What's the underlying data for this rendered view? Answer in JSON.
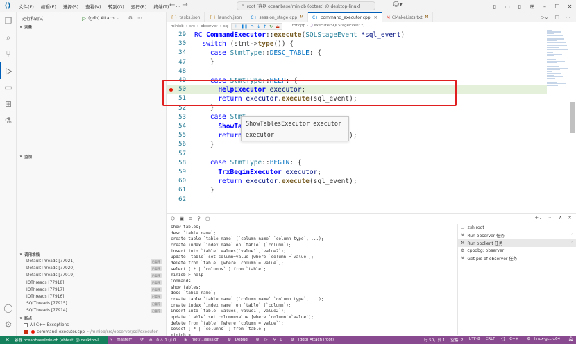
{
  "titlebar": {
    "menu": [
      "文件(F)",
      "编辑(E)",
      "选择(S)",
      "查看(V)",
      "转到(G)",
      "运行(R)",
      "终端(T)",
      "…"
    ],
    "command_center": "root [容器 oceanbase/miniob (obtest) @ desktop-linux]"
  },
  "sidebar": {
    "run_debug_title": "运行和调试",
    "config_name": "(gdb) Attach",
    "sections": {
      "variables": "变量",
      "watch": "监视",
      "call_stack": "调用堆栈",
      "breakpoints": "断点"
    },
    "threads": [
      {
        "name": "DefaultThreads [77921]",
        "state": "已暂停"
      },
      {
        "name": "DefaultThreads [77920]",
        "state": "已暂停"
      },
      {
        "name": "DefaultThreads [77919]",
        "state": "已暂停"
      },
      {
        "name": "IOThreads [77918]",
        "state": "已暂停"
      },
      {
        "name": "IOThreads [77917]",
        "state": "已暂停"
      },
      {
        "name": "IOThreads [77916]",
        "state": "已暂停"
      },
      {
        "name": "SQLThreads [77915]",
        "state": "已暂停"
      },
      {
        "name": "SQLThreads [77914]",
        "state": "已暂停"
      }
    ],
    "breakpoints": {
      "all_exceptions": "All C++ Exceptions",
      "file": "command_executor.cpp",
      "path": "~/miniob/src/observer/sql/executor"
    }
  },
  "tabs": [
    {
      "label": "tasks.json",
      "modified": "",
      "active": false
    },
    {
      "label": "launch.json",
      "modified": "",
      "active": false
    },
    {
      "label": "session_stage.cpp",
      "modified": "M",
      "active": false
    },
    {
      "label": "command_executor.cpp",
      "modified": "",
      "active": true
    },
    {
      "label": "CMakeLists.txt",
      "modified": "M",
      "active": false
    }
  ],
  "breadcrumb": {
    "parts": [
      "miniob",
      "src",
      "observer",
      "sql"
    ],
    "file": "tor.cpp",
    "symbol": "execute(SQLStageEvent *)"
  },
  "editor": {
    "lines": [
      {
        "n": "29",
        "tokens": [
          [
            "RC ",
            "kw"
          ],
          [
            "CommandExecutor",
            "cls"
          ],
          [
            "::",
            "op"
          ],
          [
            "execute",
            "fn"
          ],
          [
            "(",
            "op"
          ],
          [
            "SQLStageEvent ",
            "ty"
          ],
          [
            "*sql_event",
            "var"
          ],
          [
            ")",
            "op"
          ]
        ]
      },
      {
        "n": "30",
        "tokens": [
          [
            "  switch ",
            "kw"
          ],
          [
            "(stmt->",
            "op"
          ],
          [
            "type",
            "fn"
          ],
          [
            "()) {",
            "op"
          ]
        ]
      },
      {
        "n": "34",
        "tokens": [
          [
            "    case ",
            "kw"
          ],
          [
            "StmtType",
            "ty"
          ],
          [
            "::",
            "op"
          ],
          [
            "DESC_TABLE",
            "enm"
          ],
          [
            ": {",
            "op"
          ]
        ]
      },
      {
        "n": "47",
        "tokens": [
          [
            "    }",
            "op"
          ]
        ]
      },
      {
        "n": "48",
        "tokens": [
          [
            "",
            "op"
          ]
        ]
      },
      {
        "n": "49",
        "tokens": [
          [
            "    case ",
            "kw"
          ],
          [
            "StmtType",
            "ty"
          ],
          [
            "::",
            "op"
          ],
          [
            "HELP",
            "enm"
          ],
          [
            ": {",
            "op"
          ]
        ]
      },
      {
        "n": "50",
        "tokens": [
          [
            "      HelpExecutor ",
            "cls"
          ],
          [
            "executor",
            "var"
          ],
          [
            ";",
            "op"
          ]
        ]
      },
      {
        "n": "51",
        "tokens": [
          [
            "      return ",
            "kw"
          ],
          [
            "executor",
            "var"
          ],
          [
            ".",
            "op"
          ],
          [
            "execute",
            "fn"
          ],
          [
            "(sql_event);",
            "op"
          ]
        ]
      },
      {
        "n": "52",
        "tokens": [
          [
            "    }",
            "op"
          ]
        ]
      },
      {
        "n": "53",
        "tokens": [
          [
            "    case ",
            "kw"
          ],
          [
            "Stmt",
            "ty"
          ]
        ]
      },
      {
        "n": "54",
        "tokens": [
          [
            "      ShowTab",
            "cls"
          ]
        ]
      },
      {
        "n": "55",
        "tokens": [
          [
            "      return ",
            "kw"
          ],
          [
            "executor",
            "ul"
          ],
          [
            ".",
            "op"
          ],
          [
            "execute",
            "fn"
          ],
          [
            "(sql_event);",
            "op"
          ]
        ]
      },
      {
        "n": "56",
        "tokens": [
          [
            "    }",
            "op"
          ]
        ]
      },
      {
        "n": "57",
        "tokens": [
          [
            "",
            "op"
          ]
        ]
      },
      {
        "n": "58",
        "tokens": [
          [
            "    case ",
            "kw"
          ],
          [
            "StmtType",
            "ty"
          ],
          [
            "::",
            "op"
          ],
          [
            "BEGIN",
            "enm"
          ],
          [
            ": {",
            "op"
          ]
        ]
      },
      {
        "n": "59",
        "tokens": [
          [
            "      TrxBeginExecutor ",
            "cls"
          ],
          [
            "executor",
            "var"
          ],
          [
            ";",
            "op"
          ]
        ]
      },
      {
        "n": "60",
        "tokens": [
          [
            "      return ",
            "kw"
          ],
          [
            "executor",
            "var"
          ],
          [
            ".",
            "op"
          ],
          [
            "execute",
            "fn"
          ],
          [
            "(sql_event);",
            "op"
          ]
        ]
      },
      {
        "n": "61",
        "tokens": [
          [
            "    }",
            "op"
          ]
        ]
      },
      {
        "n": "62",
        "tokens": [
          [
            "",
            "op"
          ]
        ]
      }
    ],
    "hover": [
      "ShowTablesExecutor executor",
      "executor"
    ]
  },
  "terminal": {
    "output": "show tables;\ndesc `table name`;\ncreate table `table name` (`column name` `column type`, ...);\ncreate index `index name` on `table` (`column`);\ninsert into `table` values(`value1`,`value2`);\nupdate `table` set column=value [where `column`=`value`];\ndelete from `table` [where `column`=`value`];\nselect [ * | `columns` ] from `table`;\nminiob > help\nCommands\nshow tables;\ndesc `table name`;\ncreate table `table name` (`column name` `column type`, ...);\ncreate index `index name` on `table` (`column`);\ninsert into `table` values(`value1`,`value2`);\nupdate `table` set column=value [where `column`=`value`];\ndelete from `table` [where `column`=`value`];\nselect [ * | `columns` ] from `table`;\nminiob > ",
    "sessions": [
      {
        "label": "zsh root",
        "selected": false,
        "spinner": false
      },
      {
        "label": "Run observer 任务",
        "selected": false,
        "spinner": true
      },
      {
        "label": "Run obclient 任务",
        "selected": true,
        "spinner": true
      },
      {
        "label": "cppdbg: observer",
        "selected": false,
        "spinner": false
      },
      {
        "label": "Get pid of observer 任务",
        "selected": false,
        "spinner": false
      }
    ]
  },
  "statusbar": {
    "remote": "容器 oceanbase/miniob (obtest) @ desktop-l...",
    "branch": "master*",
    "sync": "",
    "problems": "0 ⚠ 1 ⓘ 0",
    "session": "root/.../session",
    "debug": "Debug",
    "ports": "0",
    "launch": "(gdb) Attach (root)",
    "position": "行 50，列 1",
    "spaces": "空格: 2",
    "encoding": "UTF-8",
    "eol": "CRLF",
    "language": "C++",
    "platform": "linux-gcc-x64"
  }
}
